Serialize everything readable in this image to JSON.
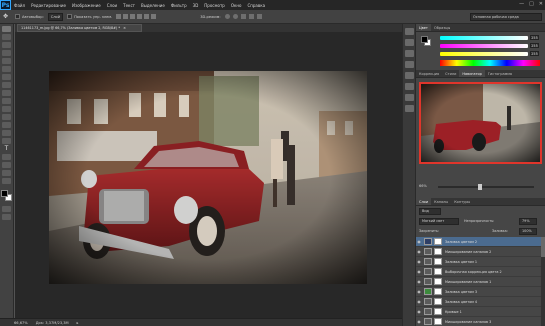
{
  "menubar": {
    "logo": "Ps",
    "items": [
      "Файл",
      "Редактирование",
      "Изображение",
      "Слои",
      "Текст",
      "Выделение",
      "Фильтр",
      "3D",
      "Просмотр",
      "Окно",
      "Справка"
    ],
    "win_controls": [
      "—",
      "□",
      "✕"
    ]
  },
  "options": {
    "autoselect_label": "Автовыбор:",
    "autoselect_value": "Слой",
    "show_controls_label": "Показать упр. элем.",
    "mode_3d_label": "3D-режим:",
    "workspace": "Основная рабочая среда"
  },
  "document": {
    "tab_title": "11461173_m.jpg @ 66,7% (Заливка цветом 2, RGB/8#) *",
    "tab_close": "×"
  },
  "status": {
    "zoom": "66,67%",
    "doc_info": "Док: 3,37M/23,3M"
  },
  "panels": {
    "color_tabs": [
      "Цвет",
      "Образцы"
    ],
    "color_values": [
      "255",
      "255",
      "255"
    ],
    "nav_tabs": [
      "Коррекция",
      "Стили",
      "Навигатор",
      "Гистограмма"
    ],
    "nav_zoom": "66%",
    "layers_tabs": [
      "Слои",
      "Каналы",
      "Контуры"
    ],
    "kind_label": "Вид",
    "blend_mode": "Мягкий свет",
    "opacity_label": "Непрозрачность:",
    "opacity_value": "79%",
    "lock_label": "Закрепить:",
    "fill_label": "Заливка:",
    "fill_value": "100%",
    "layers": [
      {
        "name": "Заливка цветом 2",
        "active": true
      },
      {
        "name": "Микширование каналов 2",
        "active": false
      },
      {
        "name": "Заливка цветом 1",
        "active": false
      },
      {
        "name": "Выборочная коррекция цвета 2",
        "active": false
      },
      {
        "name": "Микширование каналов 1",
        "active": false
      },
      {
        "name": "Заливка цветом 3",
        "active": false
      },
      {
        "name": "Заливка цветом 4",
        "active": false
      },
      {
        "name": "Кривые 1",
        "active": false
      },
      {
        "name": "Микширование каналов 3",
        "active": false
      }
    ]
  },
  "colors": {
    "accent_blue": "#31a8ff",
    "panel_bg": "#464646",
    "layer_selected": "#4b6b8f"
  }
}
